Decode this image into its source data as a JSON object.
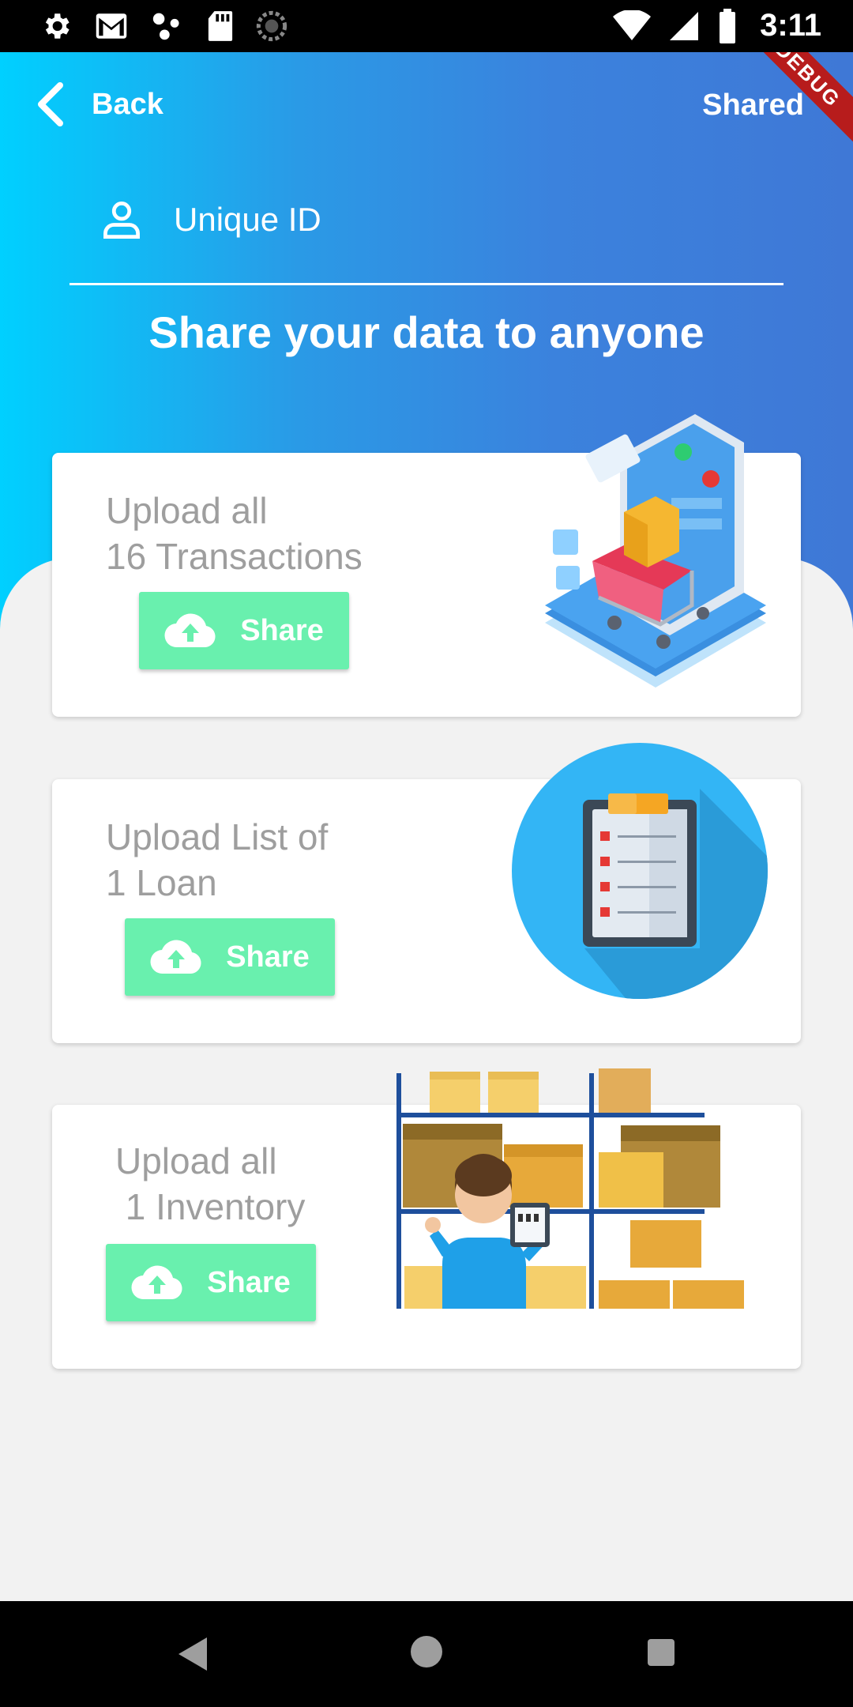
{
  "status_bar": {
    "time": "3:11",
    "icons_left": [
      "settings-icon",
      "gmail-icon",
      "dots-icon",
      "sd-card-icon",
      "loading-icon"
    ],
    "icons_right": [
      "wifi-icon",
      "signal-icon",
      "battery-icon"
    ]
  },
  "debug_banner": "DEBUG",
  "header": {
    "back_label": "Back",
    "shared_label": "Shared",
    "unique_id_label": "Unique ID",
    "title": "Share your data to anyone"
  },
  "cards": [
    {
      "line1": "Upload all",
      "line2": "16 Transactions",
      "button_label": "Share",
      "illustration": "shopping-cart-illustration"
    },
    {
      "line1": "Upload List of",
      "line2": "1 Loan",
      "button_label": "Share",
      "illustration": "clipboard-illustration"
    },
    {
      "line1": "Upload all",
      "line2": " 1 Inventory",
      "button_label": "Share",
      "illustration": "warehouse-illustration"
    }
  ],
  "colors": {
    "header_gradient_start": "#00d0ff",
    "header_gradient_end": "#3f78d6",
    "share_button": "#69f0ae",
    "card_text": "#9e9e9e",
    "background": "#f2f2f2"
  },
  "nav_bar": {
    "buttons": [
      "back-triangle-icon",
      "home-circle-icon",
      "recents-square-icon"
    ]
  }
}
